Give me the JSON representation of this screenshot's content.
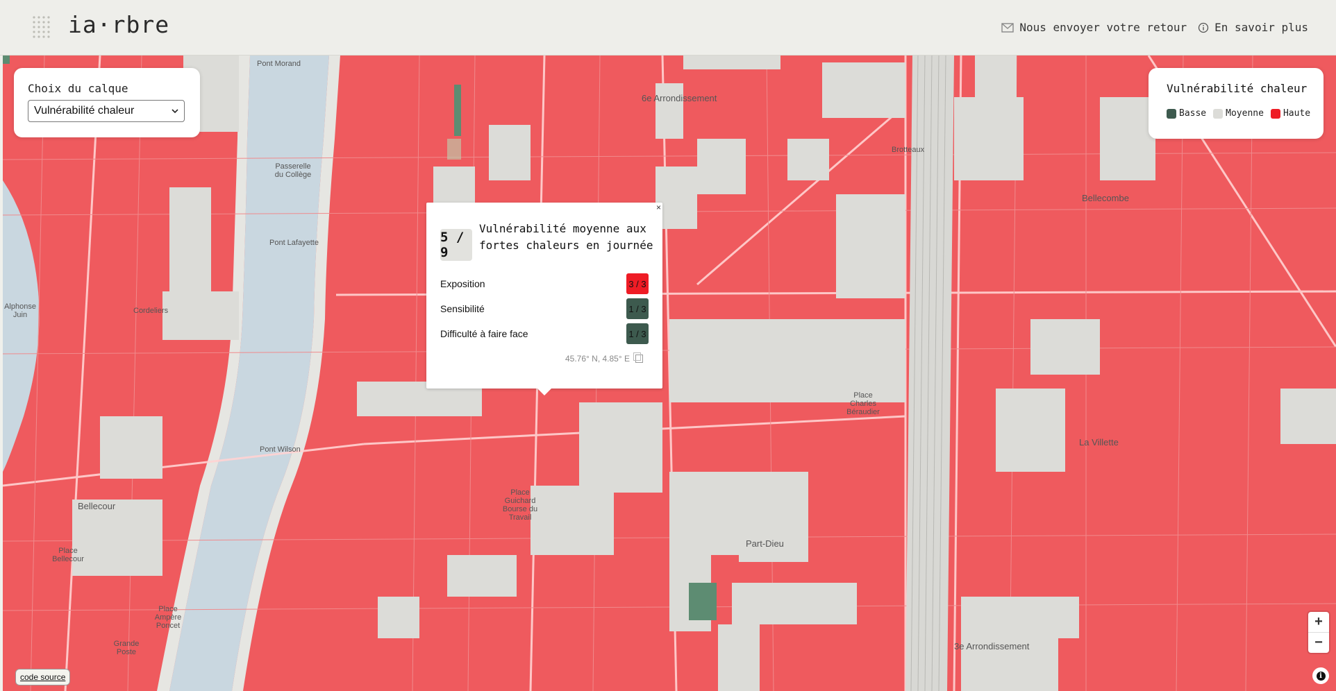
{
  "app": {
    "logo_text": "ia·rbre",
    "nav": [
      {
        "icon": "envelope-icon",
        "label": "Nous envoyer votre retour"
      },
      {
        "icon": "info-circle-icon",
        "label": "En savoir plus"
      }
    ]
  },
  "layer_panel": {
    "title": "Choix du calque",
    "selected": "Vulnérabilité chaleur"
  },
  "legend": {
    "title": "Vulnérabilité chaleur",
    "items": [
      {
        "label": "Basse",
        "color": "#3d5a4e"
      },
      {
        "label": "Moyenne",
        "color": "#dcdcd8"
      },
      {
        "label": "Haute",
        "color": "#ee1c25"
      }
    ]
  },
  "popup": {
    "close": "×",
    "score": "5 / 9",
    "title": "Vulnérabilité moyenne aux fortes chaleurs en journée",
    "rows": [
      {
        "label": "Exposition",
        "value": "3 / 3",
        "color": "#ee1c25"
      },
      {
        "label": "Sensibilité",
        "value": "1 / 3",
        "color": "#3d5a4e"
      },
      {
        "label": "Difficulté à faire face",
        "value": "1 / 3",
        "color": "#3d5a4e"
      }
    ],
    "coords": "45.76° N, 4.85° E"
  },
  "map": {
    "zoom_in": "+",
    "zoom_out": "−",
    "attribution_icon": "i",
    "labels": {
      "pont_morand": "Pont Morand",
      "passerelle": "Passerelle du Collège",
      "pont_lafayette": "Pont Lafayette",
      "pont_wilson": "Pont Wilson",
      "cordeliers": "Cordeliers",
      "bellecour": "Bellecour",
      "place_bellecour": "Place Bellecour",
      "place_ampere": "Place Ampère Poncet",
      "grande_poste": "Grande Poste",
      "arr6": "6e Arrondissement",
      "brotteaux": "Brotteaux",
      "bellecombe": "Bellecombe",
      "part_dieu": "Part-Dieu",
      "villette": "La Villette",
      "place_guichard": "Place Guichard Bourse du Travail",
      "arr3": "3e Arrondissement",
      "place_beraudier": "Place Charles Béraudier",
      "alphonse": "Alphonse Juin"
    }
  },
  "footer": {
    "source_link": "code source"
  }
}
